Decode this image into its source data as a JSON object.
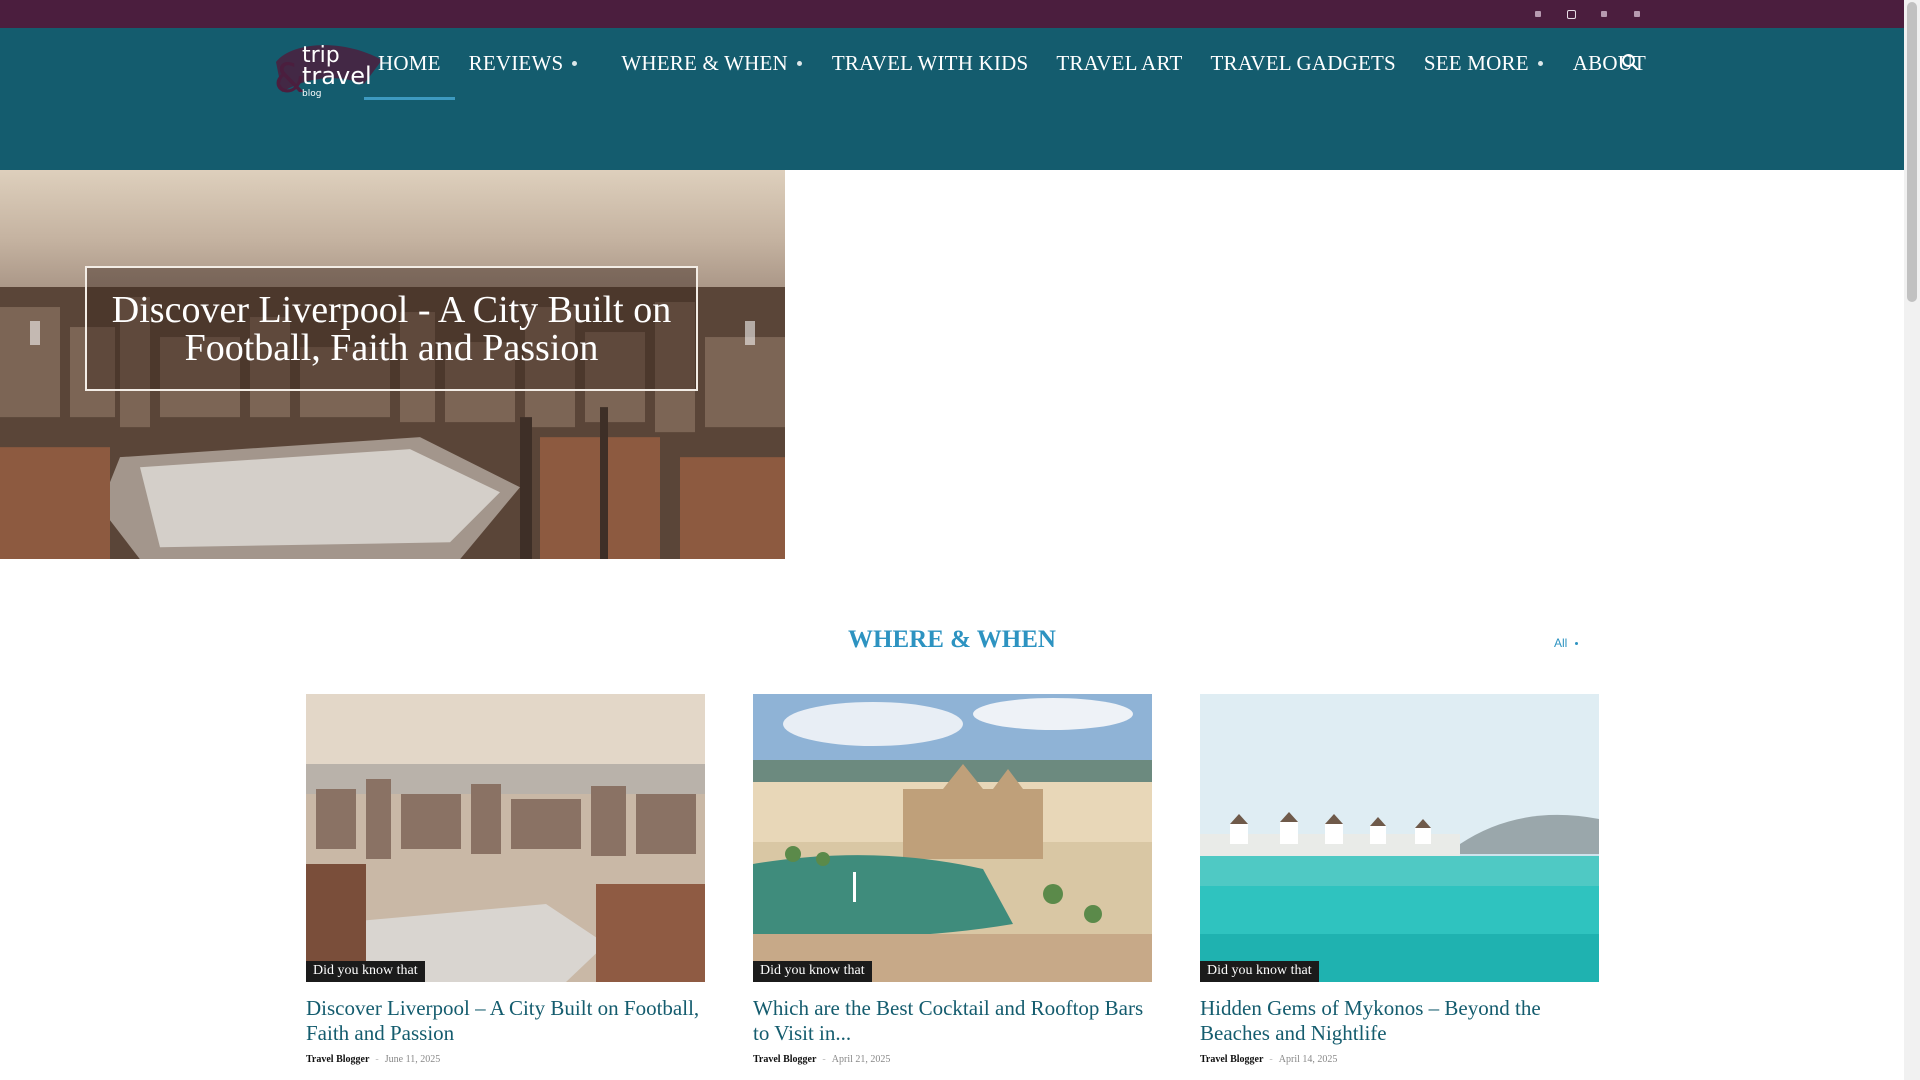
{
  "colors": {
    "topbar": "#4b1e3e",
    "header": "#145c6e",
    "accent": "#2d93c1",
    "nav_underline": "#3d9ac0",
    "badge": "#1b1b1b"
  },
  "topbar": {
    "social_icons": [
      "facebook-icon",
      "instagram-icon",
      "pinterest-icon",
      "twitter-icon"
    ]
  },
  "logo": {
    "line1": "trip",
    "line2": "travel",
    "line3": "blog",
    "ampersand": "&"
  },
  "nav": {
    "items": [
      {
        "label": "HOME",
        "active": true,
        "dropdown": false
      },
      {
        "label": "REVIEWS",
        "active": false,
        "dropdown": true
      },
      {
        "label": "WHERE & WHEN",
        "active": false,
        "dropdown": true
      },
      {
        "label": "TRAVEL WITH KIDS",
        "active": false,
        "dropdown": false
      },
      {
        "label": "TRAVEL ART",
        "active": false,
        "dropdown": false
      },
      {
        "label": "TRAVEL GADGETS",
        "active": false,
        "dropdown": false
      },
      {
        "label": "SEE MORE",
        "active": false,
        "dropdown": true
      },
      {
        "label": "ABOUT",
        "active": false,
        "dropdown": false
      }
    ],
    "search_icon": "search-icon"
  },
  "hero": {
    "title": "Discover Liverpool - A City Built on Football, Faith and Passion"
  },
  "section": {
    "title": "WHERE & WHEN",
    "all_label": "All"
  },
  "cards": [
    {
      "badge": "Did you know that",
      "title": "Discover Liverpool – A City Built on Football, Faith and Passion",
      "author": "Travel Blogger",
      "date": "June 11, 2025"
    },
    {
      "badge": "Did you know that",
      "title": "Which are the Best Cocktail and Rooftop Bars to Visit in...",
      "author": "Travel Blogger",
      "date": "April 21, 2025"
    },
    {
      "badge": "Did you know that",
      "title": "Hidden Gems of Mykonos – Beyond the Beaches and Nightlife",
      "author": "Travel Blogger",
      "date": "April 14, 2025"
    }
  ]
}
